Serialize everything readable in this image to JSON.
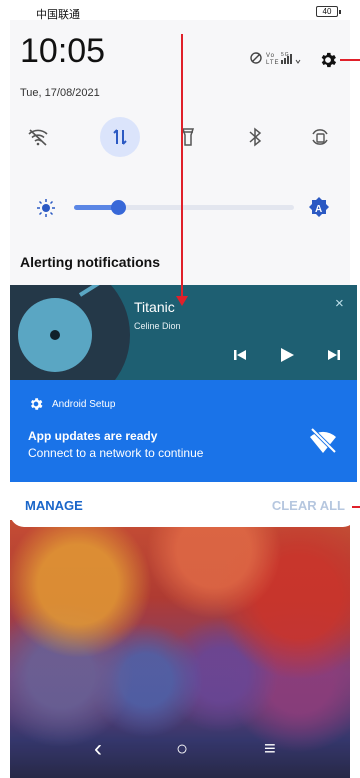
{
  "status_bar": {
    "carrier": "中国联通",
    "battery": "40"
  },
  "header": {
    "time": "10:05",
    "date": "Tue, 17/08/2021",
    "signal_text": "Vo LTE 5G"
  },
  "quick_tiles": [
    {
      "name": "wifi-off-icon",
      "active": false
    },
    {
      "name": "mobile-data-icon",
      "active": true
    },
    {
      "name": "flashlight-icon",
      "active": false
    },
    {
      "name": "bluetooth-icon",
      "active": false
    },
    {
      "name": "auto-rotate-icon",
      "active": false
    }
  ],
  "brightness": {
    "level": 0.2
  },
  "alerting": {
    "title": "Alerting notifications"
  },
  "media": {
    "title": "Titanic",
    "artist": "Celine Dion",
    "close": "×"
  },
  "setup": {
    "app": "Android Setup",
    "title": "App updates are ready",
    "text": "Connect to a network to continue"
  },
  "actions": {
    "manage": "MANAGE",
    "clear_all": "CLEAR ALL"
  },
  "nav": {
    "back": "‹",
    "home": "○",
    "menu": "≡"
  },
  "colors": {
    "accent": "#1a73e8",
    "media_bg": "#1e5f72",
    "annotation": "#e0202a"
  }
}
